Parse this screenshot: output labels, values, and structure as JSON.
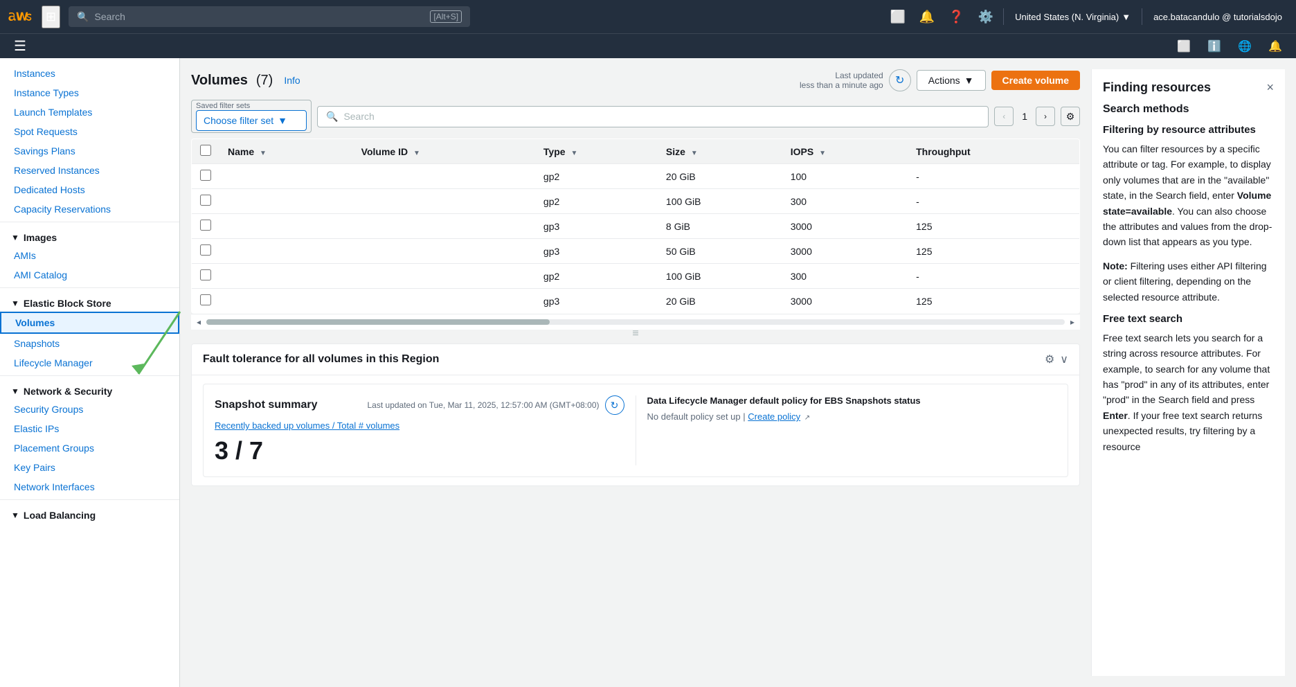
{
  "topnav": {
    "search_placeholder": "Search",
    "search_shortcut": "[Alt+S]",
    "region": "United States (N. Virginia)",
    "user": "ace.batacandulo @ tutorialsdojo"
  },
  "sidebar": {
    "instances_section": {
      "items": [
        {
          "label": "Instances",
          "id": "instances"
        },
        {
          "label": "Instance Types",
          "id": "instance-types"
        },
        {
          "label": "Launch Templates",
          "id": "launch-templates"
        },
        {
          "label": "Spot Requests",
          "id": "spot-requests"
        },
        {
          "label": "Savings Plans",
          "id": "savings-plans"
        },
        {
          "label": "Reserved Instances",
          "id": "reserved-instances"
        },
        {
          "label": "Dedicated Hosts",
          "id": "dedicated-hosts"
        },
        {
          "label": "Capacity Reservations",
          "id": "capacity-reservations"
        }
      ]
    },
    "images_section": {
      "title": "Images",
      "items": [
        {
          "label": "AMIs",
          "id": "amis"
        },
        {
          "label": "AMI Catalog",
          "id": "ami-catalog"
        }
      ]
    },
    "ebs_section": {
      "title": "Elastic Block Store",
      "items": [
        {
          "label": "Volumes",
          "id": "volumes",
          "active": true
        },
        {
          "label": "Snapshots",
          "id": "snapshots"
        },
        {
          "label": "Lifecycle Manager",
          "id": "lifecycle-manager"
        }
      ]
    },
    "network_section": {
      "title": "Network & Security",
      "items": [
        {
          "label": "Security Groups",
          "id": "security-groups"
        },
        {
          "label": "Elastic IPs",
          "id": "elastic-ips"
        },
        {
          "label": "Placement Groups",
          "id": "placement-groups"
        },
        {
          "label": "Key Pairs",
          "id": "key-pairs"
        },
        {
          "label": "Network Interfaces",
          "id": "network-interfaces"
        }
      ]
    },
    "load_balancing_section": {
      "title": "Load Balancing"
    }
  },
  "main": {
    "title": "Volumes",
    "count": "(7)",
    "info_link": "Info",
    "last_updated": "Last updated",
    "last_updated_time": "less than a minute ago",
    "actions_label": "Actions",
    "create_label": "Create volume",
    "filter_set_label": "Saved filter sets",
    "filter_placeholder": "Choose filter set",
    "search_placeholder": "Search",
    "page_number": "1",
    "table": {
      "columns": [
        "Name",
        "Volume ID",
        "Type",
        "Size",
        "IOPS",
        "Throughput"
      ],
      "rows": [
        {
          "name": "",
          "volume_id": "",
          "type": "gp2",
          "size": "20 GiB",
          "iops": "100",
          "throughput": "-"
        },
        {
          "name": "",
          "volume_id": "",
          "type": "gp2",
          "size": "100 GiB",
          "iops": "300",
          "throughput": "-"
        },
        {
          "name": "",
          "volume_id": "",
          "type": "gp3",
          "size": "8 GiB",
          "iops": "3000",
          "throughput": "125"
        },
        {
          "name": "",
          "volume_id": "",
          "type": "gp3",
          "size": "50 GiB",
          "iops": "3000",
          "throughput": "125"
        },
        {
          "name": "",
          "volume_id": "",
          "type": "gp2",
          "size": "100 GiB",
          "iops": "300",
          "throughput": "-"
        },
        {
          "name": "",
          "volume_id": "",
          "type": "gp3",
          "size": "20 GiB",
          "iops": "3000",
          "throughput": "125"
        }
      ]
    }
  },
  "fault_panel": {
    "title": "Fault tolerance for all volumes in this Region",
    "snapshot_title": "Snapshot summary",
    "snapshot_updated": "Last updated on Tue, Mar 11, 2025, 12:57:00 AM (GMT+08:00)",
    "snapshot_subtitle": "Recently backed up volumes / Total # volumes",
    "snapshot_ratio": "3 / 7",
    "dlm_title": "Data Lifecycle Manager default policy for EBS Snapshots status",
    "dlm_status": "No default policy set up",
    "dlm_link": "Create policy",
    "refresh_label": "↻"
  },
  "right_panel": {
    "title": "Finding resources",
    "close_icon": "×",
    "section_title": "Search methods",
    "subsection1_title": "Filtering by resource attributes",
    "subsection1_text1": "You can filter resources by a specific attribute or tag. For example, to display only volumes that are in the \"available\" state, in the Search field, enter ",
    "subsection1_bold": "Volume state=available",
    "subsection1_text2": ". You can also choose the attributes and values from the drop-down list that appears as you type.",
    "note_label": "Note:",
    "note_text": " Filtering uses either API filtering or client filtering, depending on the selected resource attribute.",
    "subsection2_title": "Free text search",
    "subsection2_text1": "Free text search lets you search for a string across resource attributes. For example, to search for any volume that has \"prod\" in any of its attributes, enter \"prod\" in the Search field and press ",
    "subsection2_bold": "Enter",
    "subsection2_text2": ". If your free text search returns unexpected results, try filtering by a resource"
  }
}
